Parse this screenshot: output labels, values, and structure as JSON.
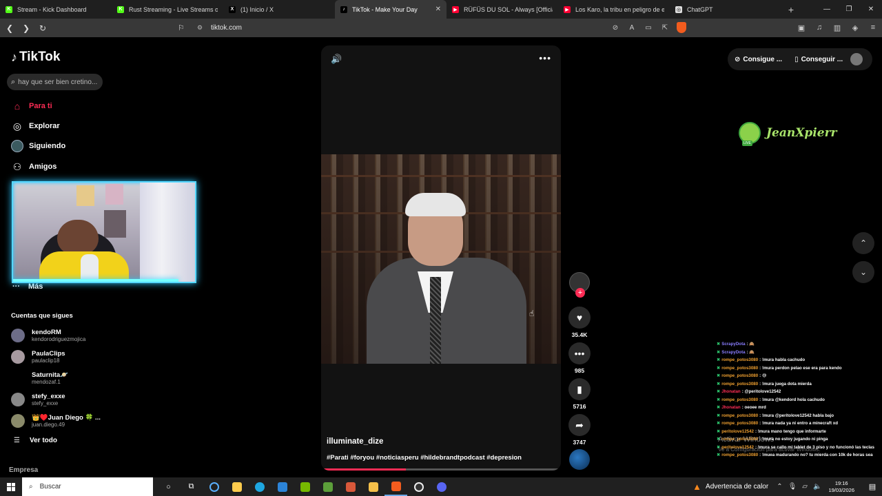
{
  "browser": {
    "tabs": [
      {
        "label": "Stream - Kick Dashboard",
        "color": "#53fc18",
        "glyph": "K"
      },
      {
        "label": "Rust Streaming - Live Streams on Kic",
        "color": "#53fc18",
        "glyph": "K"
      },
      {
        "label": "(1) Inicio / X",
        "color": "#000000",
        "glyph": "X"
      },
      {
        "label": "TikTok - Make Your Day",
        "color": "#000000",
        "glyph": "♪",
        "active": true
      },
      {
        "label": "RÜFÜS DU SOL - Always [Official Aud",
        "color": "#ff0033",
        "glyph": "▶"
      },
      {
        "label": "Los Karo, la tribu en peligro de extinc",
        "color": "#ff0033",
        "glyph": "▶"
      },
      {
        "label": "ChatGPT",
        "color": "#dddddd",
        "glyph": "◎"
      }
    ],
    "url": "tiktok.com"
  },
  "sidebar": {
    "logo": "TikTok",
    "search_placeholder": "hay que ser bien cretino...",
    "nav": [
      {
        "label": "Para ti",
        "icon": "home-icon",
        "active": true
      },
      {
        "label": "Explorar",
        "icon": "compass-icon"
      },
      {
        "label": "Siguiendo",
        "icon": "following-icon"
      },
      {
        "label": "Amigos",
        "icon": "friends-icon"
      }
    ],
    "more_label": "Más",
    "following_heading": "Cuentas que sigues",
    "accounts": [
      {
        "name": "kendoRM",
        "handle": "kendorodriguezmojica"
      },
      {
        "name": "PaulaClips",
        "handle": "paulaclip18"
      },
      {
        "name": "Saturnita🪐",
        "handle": "mendozaf.1"
      },
      {
        "name": "stefy_exxe",
        "handle": "stefy_exxe"
      },
      {
        "name": "👑♥️Juan Diego 🍀 ...",
        "handle": "juan.diego.49"
      }
    ],
    "see_all": "Ver todo",
    "company": "Empresa"
  },
  "video": {
    "author": "illuminate_dize",
    "hashtags": "#Parati #foryou #noticiasperu #hildebrandtpodcast  #depresion",
    "progress": 0.35
  },
  "actions": {
    "likes": "35.4K",
    "comments": "985",
    "saves": "5716",
    "shares": "3747"
  },
  "header": {
    "get_coins": "Consigue ...",
    "get_app": "Conseguir ...",
    "brand": "JeanXpierr",
    "live_badge": "LIVE"
  },
  "chat": [
    {
      "user": "ScrapyDota",
      "ucolor": "#8a7dff",
      "msg": "🙈"
    },
    {
      "user": "ScrapyDota",
      "ucolor": "#8a7dff",
      "msg": "🙈"
    },
    {
      "user": "rompe_potos3080",
      "ucolor": "#f0a030",
      "msg": "!mura habla cachudo"
    },
    {
      "user": "rompe_potos3080",
      "ucolor": "#f0a030",
      "msg": "!mura perdon pelao ese era para kendo"
    },
    {
      "user": "rompe_potos3080",
      "ucolor": "#f0a030",
      "msg": "😅"
    },
    {
      "user": "rompe_potos3080",
      "ucolor": "#f0a030",
      "msg": "!mura juega dota mierda"
    },
    {
      "user": "Jhonatan",
      "ucolor": "#ff2d55",
      "msg": "@peritolove12542"
    },
    {
      "user": "rompe_potos3080",
      "ucolor": "#f0a030",
      "msg": "!mura @kendord hola cachudo"
    },
    {
      "user": "Jhonatan",
      "ucolor": "#ff2d55",
      "msg": "oeoee mrd"
    },
    {
      "user": "rompe_potos3080",
      "ucolor": "#f0a030",
      "msg": "!mura @peritolove12542 habla bajo"
    },
    {
      "user": "rompe_potos3080",
      "ucolor": "#f0a030",
      "msg": "!mura nada ya ni entro a minecraft xd"
    },
    {
      "user": "peritolove12542",
      "ucolor": "#f0a030",
      "msg": "!mura mano tengo que informarte"
    },
    {
      "user": "rompe_potos3080",
      "ucolor": "#f0a030",
      "msg": "!mura no estoy jugando ni pinga"
    },
    {
      "user": "peritolove12542",
      "ucolor": "#f0a030",
      "msg": "!mura se callo mi tablet de 3 piso y no funcionó las teclas"
    },
    {
      "user": "rompe_potos3080",
      "ucolor": "#f0a030",
      "msg": "!muea madurando no? tu mierda con 10k de horas sea"
    }
  ],
  "watermark": {
    "line1": "Activar Windows",
    "line2": "Ve a Configuración para activar Windows."
  },
  "taskbar": {
    "search": "Buscar",
    "weather": "Advertencia de calor",
    "time": "19:16",
    "date": "19/03/2026"
  }
}
